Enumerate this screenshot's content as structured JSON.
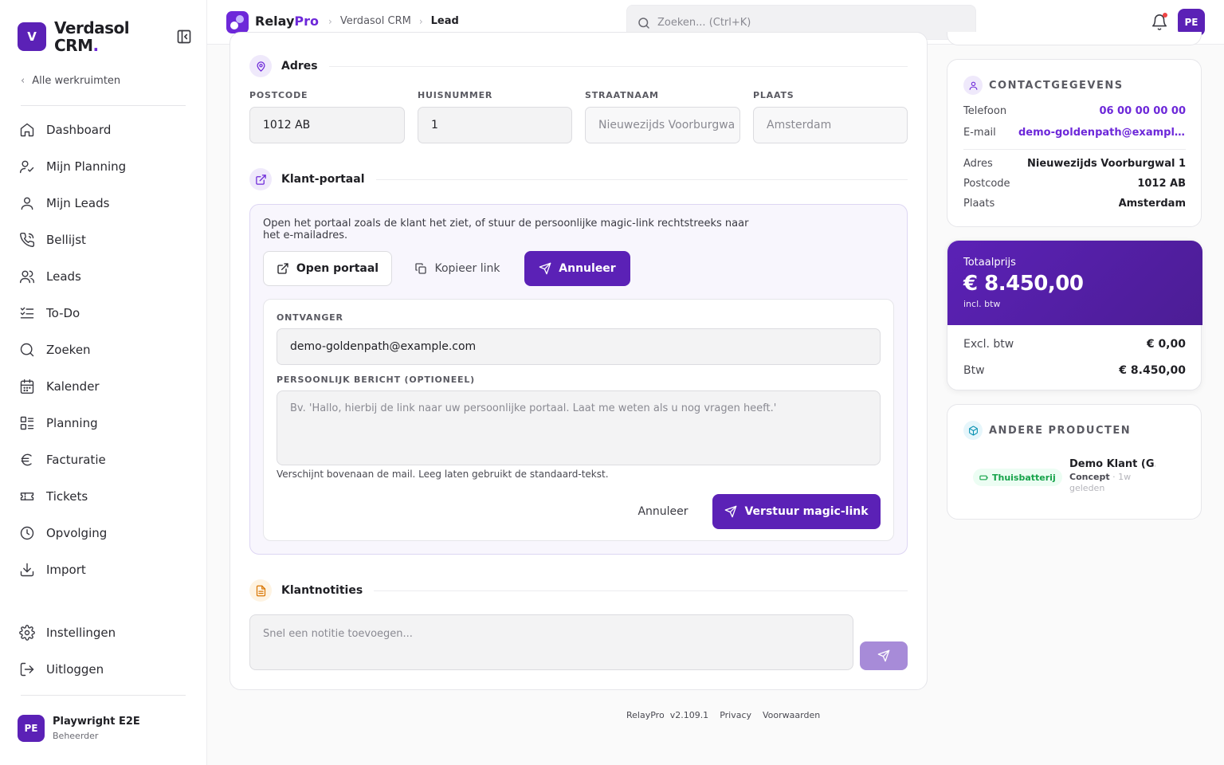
{
  "sidebar": {
    "brand_initial": "V",
    "brand_name_1": "Verdasol",
    "brand_name_2": "CRM",
    "brand_dot": ".",
    "back_label": "Alle werkruimten",
    "nav": [
      {
        "label": "Dashboard",
        "icon": "home-icon"
      },
      {
        "label": "Mijn Planning",
        "icon": "user-check-icon"
      },
      {
        "label": "Mijn Leads",
        "icon": "user-icon"
      },
      {
        "label": "Bellijst",
        "icon": "phone-icon"
      },
      {
        "label": "Leads",
        "icon": "users-icon"
      },
      {
        "label": "To-Do",
        "icon": "list-check-icon"
      },
      {
        "label": "Zoeken",
        "icon": "search-icon"
      },
      {
        "label": "Kalender",
        "icon": "calendar-icon"
      },
      {
        "label": "Planning",
        "icon": "list-icon"
      },
      {
        "label": "Facturatie",
        "icon": "euro-icon"
      },
      {
        "label": "Tickets",
        "icon": "ticket-icon"
      },
      {
        "label": "Opvolging",
        "icon": "clock-icon"
      },
      {
        "label": "Import",
        "icon": "download-icon"
      }
    ],
    "nav_bottom": [
      {
        "label": "Instellingen",
        "icon": "gear-icon"
      },
      {
        "label": "Uitloggen",
        "icon": "logout-icon"
      }
    ],
    "user": {
      "initials": "PE",
      "name": "Playwright E2E",
      "role": "Beheerder"
    }
  },
  "topbar": {
    "brand_relay": "Relay",
    "brand_pro": "Pro",
    "breadcrumb": [
      "Verdasol CRM",
      "Lead"
    ],
    "search_placeholder": "Zoeken... (Ctrl+K)",
    "avatar_initials": "PE"
  },
  "address": {
    "title": "Adres",
    "fields": [
      {
        "label": "POSTCODE",
        "value": "1012 AB"
      },
      {
        "label": "HUISNUMMER",
        "value": "1"
      },
      {
        "label": "STRAATNAAM",
        "value": "Nieuwezijds Voorburgwa"
      },
      {
        "label": "PLAATS",
        "value": "Amsterdam"
      }
    ]
  },
  "portal": {
    "title": "Klant-portaal",
    "description": "Open het portaal zoals de klant het ziet, of stuur de persoonlijke magic-link rechtstreeks naar het e-mailadres.",
    "open_button": "Open portaal",
    "copy_button": "Kopieer link",
    "cancel_button_top": "Annuleer",
    "recipient_label": "ONTVANGER",
    "recipient_value": "demo-goldenpath@example.com",
    "message_label": "PERSOONLIJK BERICHT (OPTIONEEL)",
    "message_placeholder": "Bv. 'Hallo, hierbij de link naar uw persoonlijke portaal. Laat me weten als u nog vragen heeft.'",
    "hint": "Verschijnt bovenaan de mail. Leeg laten gebruikt de standaard-tekst.",
    "cancel_button": "Annuleer",
    "send_button": "Verstuur magic-link"
  },
  "notes": {
    "title": "Klantnotities",
    "placeholder": "Snel een notitie toevoegen..."
  },
  "footer": {
    "brand": "RelayPro",
    "version": "v2.109.1",
    "privacy": "Privacy",
    "terms": "Voorwaarden"
  },
  "contact": {
    "title": "CONTACTGEGEVENS",
    "phone_label": "Telefoon",
    "phone": "06 00 00 00 00",
    "email_label": "E-mail",
    "email": "demo-goldenpath@example.com",
    "address_label": "Adres",
    "address": "Nieuwezijds Voorburgwal 1",
    "postcode_label": "Postcode",
    "postcode": "1012 AB",
    "city_label": "Plaats",
    "city": "Amsterdam"
  },
  "total": {
    "label": "Totaalprijs",
    "amount": "€ 8.450,00",
    "sub": "incl. btw",
    "excl_label": "Excl. btw",
    "excl_value": "€ 0,00",
    "btw_label": "Btw",
    "btw_value": "€ 8.450,00"
  },
  "products": {
    "title": "ANDERE PRODUCTEN",
    "items": [
      {
        "badge": "Thuisbatterij",
        "name": "Demo Klant (G...",
        "status": "Concept",
        "time": "· 1w geleden"
      }
    ]
  },
  "colors": {
    "accent": "#5b21b6",
    "accent_light": "#6d28d9",
    "success": "#16a34a",
    "notification": "#ef4444"
  }
}
